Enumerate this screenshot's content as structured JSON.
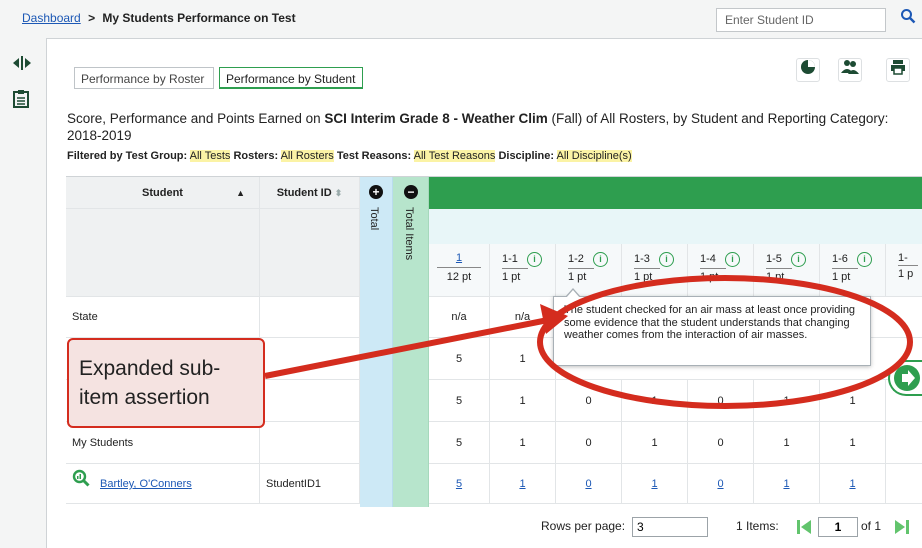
{
  "breadcrumb": {
    "home": "Dashboard",
    "separator": ">",
    "current": "My Students Performance on Test"
  },
  "search": {
    "placeholder": "Enter Student ID",
    "icon": "search-icon"
  },
  "tabs": [
    {
      "label": "Performance by Roster",
      "active": false
    },
    {
      "label": "Performance by Student",
      "active": true
    }
  ],
  "toolbar_icons": [
    "pie-chart-icon",
    "students-icon",
    "print-icon"
  ],
  "heading": {
    "prefix": "Score, Performance and Points Earned on ",
    "test_name": "SCI Interim Grade 8 - Weather Clim",
    "suffix": " (Fall) of All Rosters, by Student and Reporting Category: 2018-2019"
  },
  "filters": [
    {
      "label": "Filtered by Test Group:",
      "value": "All Tests"
    },
    {
      "label": "Rosters:",
      "value": "All Rosters"
    },
    {
      "label": "Test Reasons:",
      "value": "All Test Reasons"
    },
    {
      "label": "Discipline:",
      "value": "All Discipline(s)"
    }
  ],
  "table": {
    "col_student": "Student",
    "col_student_id": "Student ID",
    "col_total": "Total",
    "col_total_items": "Total Items",
    "expand_icon": "+",
    "collapse_icon": "−",
    "category": {
      "label": "1",
      "points": "12 pt"
    },
    "items": [
      {
        "label": "1-1",
        "points": "1 pt"
      },
      {
        "label": "1-2",
        "points": "1 pt"
      },
      {
        "label": "1-3",
        "points": "1 pt"
      },
      {
        "label": "1-4",
        "points": "1 pt"
      },
      {
        "label": "1-5",
        "points": "1 pt"
      },
      {
        "label": "1-6",
        "points": "1 pt"
      },
      {
        "label": "1-",
        "points": "1 p"
      }
    ],
    "rows": [
      {
        "name": "State",
        "id": "",
        "cat": "n/a",
        "vals": [
          "n/a",
          "",
          "",
          "",
          "",
          "",
          ""
        ]
      },
      {
        "name": "",
        "id": "",
        "cat": "5",
        "vals": [
          "1",
          "",
          "",
          "",
          "",
          "",
          ""
        ]
      },
      {
        "name": "",
        "id": "",
        "cat": "5",
        "vals": [
          "1",
          "0",
          "1",
          "0",
          "1",
          "1",
          ""
        ]
      },
      {
        "name": "My Students",
        "id": "",
        "cat": "5",
        "vals": [
          "1",
          "0",
          "1",
          "0",
          "1",
          "1",
          ""
        ]
      },
      {
        "name": "Bartley, O'Conners",
        "id": "StudentID1",
        "cat": "5",
        "vals": [
          "1",
          "0",
          "1",
          "0",
          "1",
          "1",
          ""
        ],
        "link": true
      }
    ]
  },
  "tooltip": "The student checked for an air mass at least once providing some evidence that the student understands that changing weather comes from the interaction of air masses.",
  "annotation": "Expanded sub-item assertion",
  "pagination": {
    "rows_label": "Rows per page:",
    "rows_value": "3",
    "items_label": "1 Items:",
    "page_value": "1",
    "of_label": "of 1"
  },
  "colors": {
    "accent_green": "#2e9e4f",
    "total_col": "#cde9f6",
    "total_items_col": "#b7e5cc",
    "annotation_red": "#d42c1e"
  }
}
